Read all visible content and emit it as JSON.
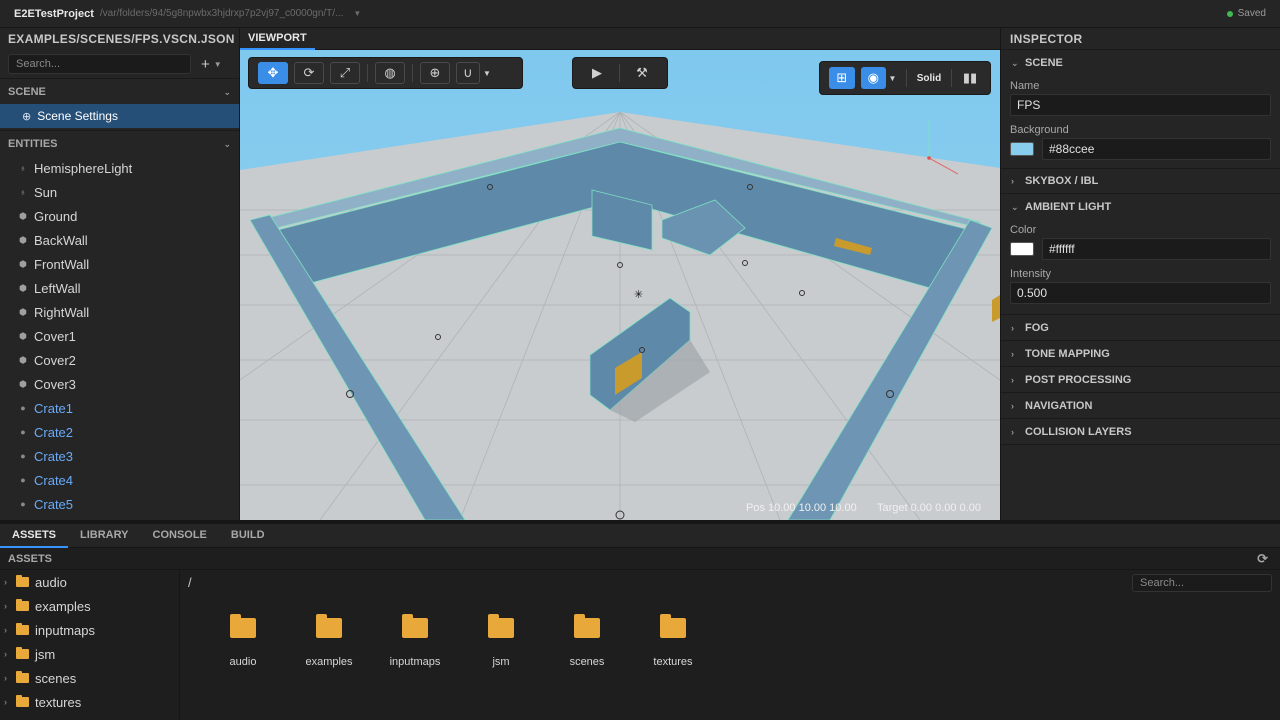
{
  "titlebar": {
    "project": "E2ETestProject",
    "path": "/var/folders/94/5g8npwbx3hjdrxp7p2vj97_c0000gn/T/...",
    "status": "Saved"
  },
  "left_panel": {
    "title": "EXAMPLES/SCENES/FPS.VSCN.JSON",
    "search_placeholder": "Search...",
    "add_label": "+",
    "scene_section": "SCENE",
    "scene_settings": "Scene Settings",
    "entities_section": "ENTITIES",
    "entities": [
      {
        "label": "HemisphereLight",
        "icon": "light-bulb-icon",
        "kind": "light"
      },
      {
        "label": "Sun",
        "icon": "light-bulb-icon",
        "kind": "light"
      },
      {
        "label": "Ground",
        "icon": "mesh-icon",
        "kind": "mesh"
      },
      {
        "label": "BackWall",
        "icon": "mesh-icon",
        "kind": "mesh"
      },
      {
        "label": "FrontWall",
        "icon": "mesh-icon",
        "kind": "mesh"
      },
      {
        "label": "LeftWall",
        "icon": "mesh-icon",
        "kind": "mesh"
      },
      {
        "label": "RightWall",
        "icon": "mesh-icon",
        "kind": "mesh"
      },
      {
        "label": "Cover1",
        "icon": "mesh-icon",
        "kind": "mesh"
      },
      {
        "label": "Cover2",
        "icon": "mesh-icon",
        "kind": "mesh"
      },
      {
        "label": "Cover3",
        "icon": "mesh-icon",
        "kind": "mesh"
      },
      {
        "label": "Crate1",
        "icon": "sphere-icon",
        "kind": "prefab"
      },
      {
        "label": "Crate2",
        "icon": "sphere-icon",
        "kind": "prefab"
      },
      {
        "label": "Crate3",
        "icon": "sphere-icon",
        "kind": "prefab"
      },
      {
        "label": "Crate4",
        "icon": "sphere-icon",
        "kind": "prefab"
      },
      {
        "label": "Crate5",
        "icon": "sphere-icon",
        "kind": "prefab"
      }
    ]
  },
  "viewport": {
    "tab": "VIEWPORT",
    "render_mode": "Solid",
    "pos": "Pos 10.00 10.00 10.00",
    "target": "Target 0.00 0.00 0.00"
  },
  "inspector": {
    "title": "INSPECTOR",
    "scene_section": "SCENE",
    "name_label": "Name",
    "name_value": "FPS",
    "background_label": "Background",
    "background_value": "#88ccee",
    "skybox_section": "SKYBOX / IBL",
    "ambient_section": "AMBIENT LIGHT",
    "color_label": "Color",
    "color_value": "#ffffff",
    "intensity_label": "Intensity",
    "intensity_value": "0.500",
    "collapsed_sections": [
      "FOG",
      "TONE MAPPING",
      "POST PROCESSING",
      "NAVIGATION",
      "COLLISION LAYERS"
    ]
  },
  "bottom": {
    "tabs": [
      "ASSETS",
      "LIBRARY",
      "CONSOLE",
      "BUILD"
    ],
    "active_tab": "ASSETS",
    "assets_header": "ASSETS",
    "path": "/",
    "search_placeholder": "Search...",
    "folders": [
      "audio",
      "examples",
      "inputmaps",
      "jsm",
      "scenes",
      "textures"
    ]
  },
  "colors": {
    "accent": "#3b8ee8",
    "selection": "#264f78",
    "folder": "#e8a93a",
    "saved_dot": "#3fb950",
    "crate_text": "#6aabf7",
    "background_swatch": "#88ccee",
    "ambient_swatch": "#ffffff"
  }
}
